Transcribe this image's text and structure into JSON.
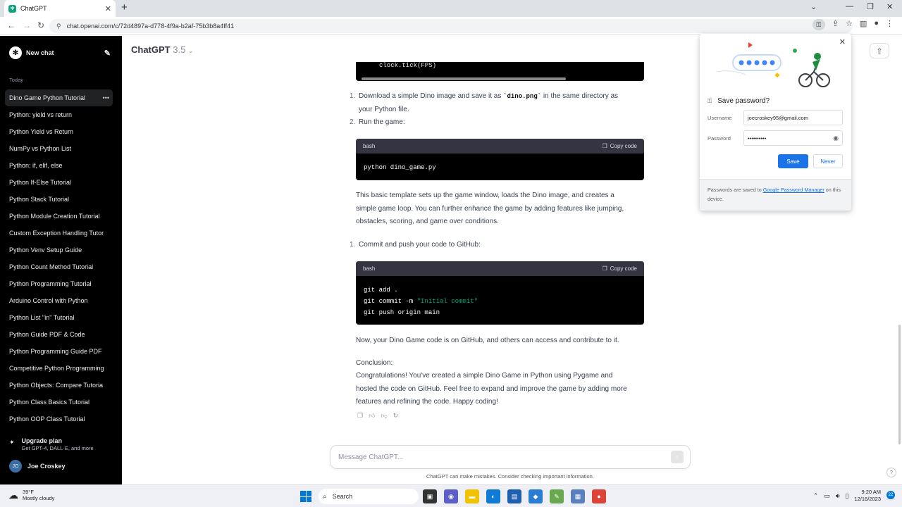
{
  "browser": {
    "tab_title": "ChatGPT",
    "url": "chat.openai.com/c/72d4897a-d778-4f9a-b2af-75b3b8a4ff41"
  },
  "sidebar": {
    "new_chat": "New chat",
    "section_today": "Today",
    "items": [
      {
        "label": "Dino Game Python Tutorial",
        "active": true
      },
      {
        "label": "Python: yield vs return"
      },
      {
        "label": "Python Yield vs Return"
      },
      {
        "label": "NumPy vs Python List"
      },
      {
        "label": "Python: if, elif, else"
      },
      {
        "label": "Python If-Else Tutorial"
      },
      {
        "label": "Python Stack Tutorial"
      },
      {
        "label": "Python Module Creation Tutorial"
      },
      {
        "label": "Custom Exception Handling Tutor"
      },
      {
        "label": "Python Venv Setup Guide"
      },
      {
        "label": "Python Count Method Tutorial"
      },
      {
        "label": "Python Programming Tutorial"
      },
      {
        "label": "Arduino Control with Python"
      },
      {
        "label": "Python List \"in\" Tutorial"
      },
      {
        "label": "Python Guide PDF & Code"
      },
      {
        "label": "Python Programming Guide PDF"
      },
      {
        "label": "Competitive Python Programming"
      },
      {
        "label": "Python Objects: Compare Tutoria"
      },
      {
        "label": "Python Class Basics Tutorial"
      },
      {
        "label": "Python OOP Class Tutorial"
      }
    ],
    "upgrade_title": "Upgrade plan",
    "upgrade_sub": "Get GPT-4, DALL·E, and more",
    "user_initials": "JO",
    "user_name": "Joe Croskey"
  },
  "main": {
    "model_name": "ChatGPT",
    "model_version": "3.5",
    "top_code_line": "clock.tick(FPS)",
    "step1_num": "1.",
    "step1_pre": "Download a simple Dino image and save it as ",
    "step1_code": "`dino.png`",
    "step1_post": " in the same directory as",
    "step1_line2": "your Python file.",
    "step2_num": "2.",
    "step2": "Run the game:",
    "code1_lang": "bash",
    "copy_label": "Copy code",
    "code1": "python dino_game.py",
    "para1_l1": "This basic template sets up the game window, loads the Dino image, and creates a",
    "para1_l2": "simple game loop. You can further enhance the game by adding features like jumping,",
    "para1_l3": "obstacles, scoring, and game over conditions.",
    "step3_num": "1.",
    "step3": "Commit and push your code to GitHub:",
    "code2_lang": "bash",
    "code2_l1": "git add .",
    "code2_l2_pre": "git commit -m ",
    "code2_l2_str": "\"Initial commit\"",
    "code2_l3": "git push origin main",
    "para2": "Now, your Dino Game code is on GitHub, and others can access and contribute to it.",
    "conclusion_head": "Conclusion:",
    "concl_l1": "Congratulations! You've created a simple Dino Game in Python using Pygame and",
    "concl_l2": "hosted the code on GitHub. Feel free to expand and improve the game by adding more",
    "concl_l3": "features and refining the code. Happy coding!",
    "composer_placeholder": "Message ChatGPT...",
    "disclaimer": "ChatGPT can make mistakes. Consider checking important information.",
    "help": "?"
  },
  "password_popup": {
    "title": "Save password?",
    "username_label": "Username",
    "username": "joecroskey95@gmail.com",
    "password_label": "Password",
    "password": "••••••••••",
    "save": "Save",
    "never": "Never",
    "footer_pre": "Passwords are saved to ",
    "footer_link": "Google Password Manager",
    "footer_post": " on this device."
  },
  "taskbar": {
    "temp": "39°F",
    "weather": "Mostly cloudy",
    "search": "Search",
    "time": "9:20 AM",
    "date": "12/16/2023",
    "notif_count": "22"
  },
  "colors": {
    "sidebar_bg": "#000000",
    "accent_green": "#10a37f",
    "google_blue": "#1a73e8"
  }
}
